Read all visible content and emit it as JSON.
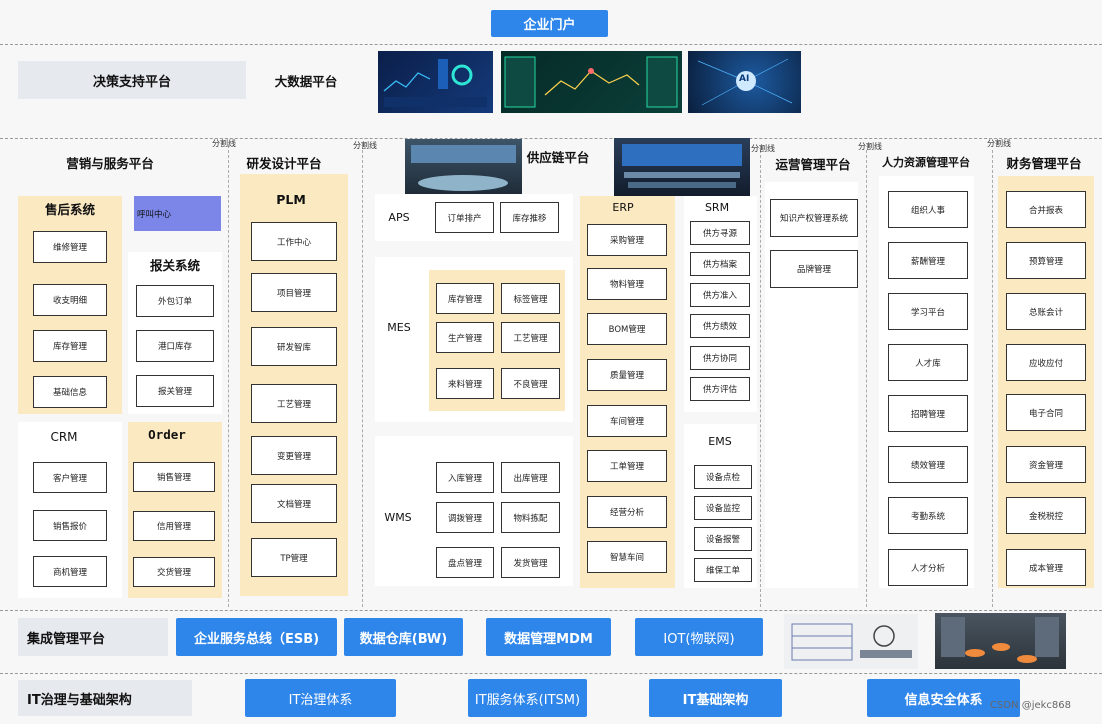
{
  "portal": "企业门户",
  "decision": {
    "label": "决策支持平台",
    "bigdata": "大数据平台"
  },
  "separator": "分割线",
  "platforms": {
    "marketing": "营销与服务平台",
    "rnd": "研发设计平台",
    "supply": "供应链平台",
    "ops": "运营管理平台",
    "hr": "人力资源管理平台",
    "finance": "财务管理平台"
  },
  "aftersales": {
    "title": "售后系统",
    "items": [
      "维修管理",
      "收支明细",
      "库存管理",
      "基础信息"
    ]
  },
  "callcenter": "呼叫中心",
  "customs": {
    "title": "报关系统",
    "items": [
      "外包订单",
      "港口库存",
      "报关管理"
    ]
  },
  "crm": {
    "title": "CRM",
    "items": [
      "客户管理",
      "销售报价",
      "商机管理"
    ]
  },
  "order": {
    "title": "Order",
    "items": [
      "销售管理",
      "信用管理",
      "交货管理"
    ]
  },
  "plm": {
    "title": "PLM",
    "items": [
      "工作中心",
      "项目管理",
      "研发智库",
      "工艺管理",
      "变更管理",
      "文档管理",
      "TP管理"
    ]
  },
  "aps": {
    "title": "APS",
    "items": [
      "订单排产",
      "库存推移"
    ]
  },
  "mes": {
    "title": "MES",
    "items": [
      "库存管理",
      "标签管理",
      "生产管理",
      "工艺管理",
      "来料管理",
      "不良管理"
    ]
  },
  "wms": {
    "title": "WMS",
    "items": [
      "入库管理",
      "出库管理",
      "调拨管理",
      "物料拣配",
      "盘点管理",
      "发货管理"
    ]
  },
  "erp": {
    "title": "ERP",
    "items": [
      "采购管理",
      "物料管理",
      "BOM管理",
      "质量管理",
      "车间管理",
      "工单管理",
      "经营分析",
      "智慧车间"
    ]
  },
  "srm": {
    "title": "SRM",
    "items": [
      "供方寻源",
      "供方档案",
      "供方准入",
      "供方绩效",
      "供方协同",
      "供方评估"
    ]
  },
  "ems": {
    "title": "EMS",
    "items": [
      "设备点检",
      "设备监控",
      "设备报警",
      "维保工单"
    ]
  },
  "ops_items": [
    "知识产权管理系统",
    "品牌管理"
  ],
  "hr_items": [
    "组织人事",
    "薪酬管理",
    "学习平台",
    "人才库",
    "招聘管理",
    "绩效管理",
    "考勤系统",
    "人才分析"
  ],
  "fin_items": [
    "合并报表",
    "预算管理",
    "总账会计",
    "应收应付",
    "电子合同",
    "资金管理",
    "金税税控",
    "成本管理"
  ],
  "integration": {
    "label": "集成管理平台",
    "items": [
      "企业服务总线（ESB)",
      "数据仓库(BW)",
      "数据管理MDM",
      "IOT(物联网)"
    ]
  },
  "it": {
    "label": "IT治理与基础架构",
    "items": [
      "IT治理体系",
      "IT服务体系(ITSM)",
      "IT基础架构",
      "信息安全体系"
    ]
  },
  "watermark": "CSDN @jekc868",
  "dashboard_ai": "AI",
  "colors": {
    "blue": "#2f86ea",
    "cream": "#fbe9c2",
    "gray": "#e6e9ee",
    "purple": "#7b86e8"
  }
}
